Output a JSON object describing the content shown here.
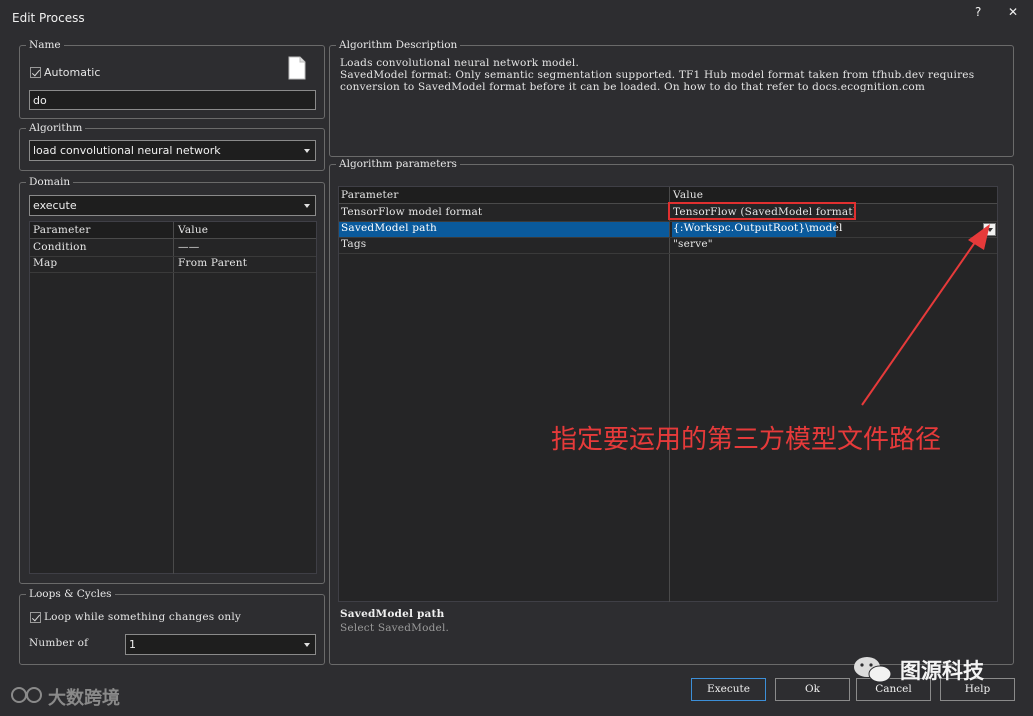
{
  "window": {
    "title": "Edit Process",
    "help_btn": "?",
    "close_btn": "✕"
  },
  "name_group": {
    "label": "Name",
    "automatic_label": "Automatic",
    "automatic_checked": true,
    "name_value": "do"
  },
  "algorithm_group": {
    "label": "Algorithm",
    "selected": "load convolutional neural network"
  },
  "domain_group": {
    "label": "Domain",
    "selected": "execute",
    "columns": [
      "Parameter",
      "Value"
    ],
    "rows": [
      {
        "parameter": "Condition",
        "value": "——"
      },
      {
        "parameter": "Map",
        "value": "From Parent"
      }
    ]
  },
  "loops_group": {
    "label": "Loops & Cycles",
    "loop_label": "Loop while something changes only",
    "loop_checked": true,
    "number_of_label": "Number of",
    "number_value": "1"
  },
  "description_group": {
    "label": "Algorithm Description",
    "lines": [
      "Loads convolutional neural network model.",
      "SavedModel format: Only semantic segmentation supported. TF1 Hub model format taken from tfhub.dev requires",
      "conversion to SavedModel format before it can be loaded. On how to do that refer to docs.ecognition.com"
    ]
  },
  "params_group": {
    "label": "Algorithm parameters",
    "columns": [
      "Parameter",
      "Value"
    ],
    "rows": [
      {
        "parameter": "TensorFlow model format",
        "value": "TensorFlow (SavedModel format)"
      },
      {
        "parameter": "SavedModel path",
        "value": "{:Workspc.OutputRoot}\\model"
      },
      {
        "parameter": "Tags",
        "value": "\"serve\""
      }
    ],
    "help_title": "SavedModel path",
    "help_text": "Select SavedModel."
  },
  "buttons": {
    "execute": "Execute",
    "ok": "Ok",
    "cancel": "Cancel",
    "help": "Help"
  },
  "annotation": {
    "text": "指定要运用的第三方模型文件路径",
    "color": "#e63a3a"
  },
  "watermarks": {
    "left": "大数跨境",
    "right": "图源科技"
  },
  "colors": {
    "selection": "#0a5a9c",
    "accent_border": "#3c8fd8"
  }
}
